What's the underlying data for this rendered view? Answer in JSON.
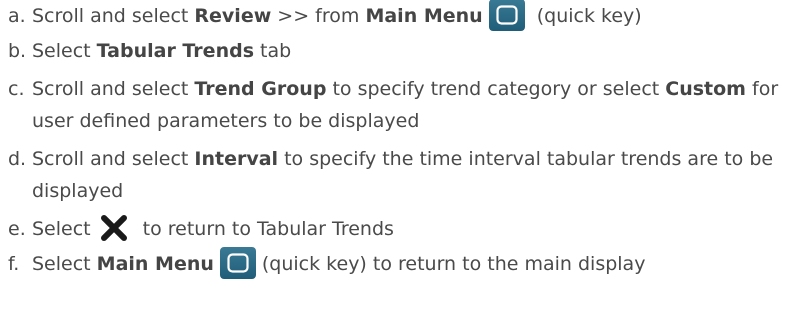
{
  "steps": [
    {
      "marker": "a.",
      "t1": "Scroll and select ",
      "b1": "Review",
      "t2": " >> from ",
      "b2": "Main Menu",
      "icon": "main-menu-key-icon",
      "t3": " (quick key)"
    },
    {
      "marker": "b.",
      "t1": "Select ",
      "b1": "Tabular Trends",
      "t2": " tab"
    },
    {
      "marker": "c.",
      "t1": "Scroll and select ",
      "b1": "Trend Group",
      "t2": " to specify trend category or select ",
      "b2": "Custom",
      "t3": " for user defined parameters to be displayed"
    },
    {
      "marker": "d.",
      "t1": "Scroll and select ",
      "b1": "Interval",
      "t2": " to specify the time interval tabular trends are to be displayed"
    },
    {
      "marker": "e.",
      "t1": "Select",
      "icon": "close-x-icon",
      "t2": " to return to Tabular Trends"
    },
    {
      "marker": "f.",
      "t1": "Select ",
      "b1": "Main Menu",
      "icon": "main-menu-key-icon",
      "t2": "(quick key) to return to the main display"
    }
  ],
  "colors": {
    "text": "#4a4a4a",
    "key_background": "#2b6a86",
    "key_glyph": "#ffffff",
    "close_x": "#1a1a1a"
  }
}
